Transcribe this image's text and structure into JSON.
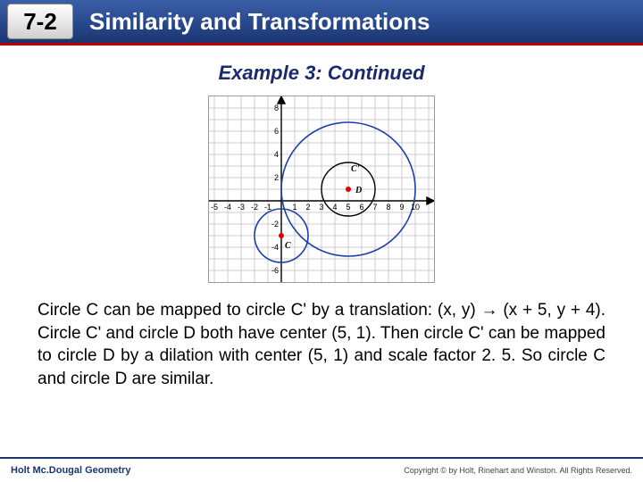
{
  "header": {
    "lesson": "7-2",
    "title": "Similarity and Transformations"
  },
  "example_title": "Example 3: Continued",
  "body_text": "Circle C can be mapped to circle C' by a translation: (x, y) → (x + 5, y + 4). Circle C' and circle D both have center (5, 1). Then circle C' can be mapped to circle D by a dilation with center (5, 1) and scale factor 2. 5. So circle C and circle D are similar.",
  "footer": {
    "left": "Holt Mc.Dougal Geometry",
    "right": "Copyright © by Holt, Rinehart and Winston. All Rights Reserved."
  },
  "chart_data": {
    "type": "diagram",
    "title": "",
    "x_ticks": [
      -5,
      -4,
      -3,
      -2,
      -1,
      1,
      2,
      3,
      4,
      5,
      6,
      7,
      8,
      9,
      10
    ],
    "y_ticks": [
      -6,
      -4,
      -2,
      2,
      4,
      6,
      8
    ],
    "xlim": [
      -5,
      11
    ],
    "ylim": [
      -7,
      9
    ],
    "points": [
      {
        "name": "C",
        "x": 0,
        "y": -3,
        "label_pos": "below"
      },
      {
        "name": "C'",
        "x": 5,
        "y": 1,
        "label_pos": "above-right"
      },
      {
        "name": "D",
        "x": 5,
        "y": 1,
        "label_pos": "right"
      }
    ],
    "circles": [
      {
        "name": "C",
        "cx": 0,
        "cy": -3,
        "r": 2,
        "color": "#1a3fa8"
      },
      {
        "name": "C'",
        "cx": 5,
        "cy": 1,
        "r": 2,
        "color": "#000"
      },
      {
        "name": "D",
        "cx": 5,
        "cy": 1,
        "r": 5,
        "color": "#1a3fa8"
      }
    ]
  }
}
